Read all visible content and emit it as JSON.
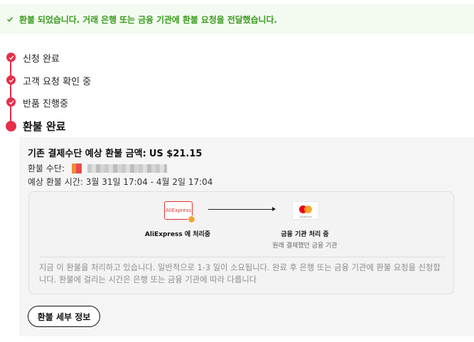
{
  "banner": {
    "message": "환불 되었습니다. 거래 은행 또는 금융 기관에 환불 요청을 전달했습니다.",
    "icon": "check-icon",
    "color": "#3b9c1f"
  },
  "timeline": {
    "accent": "#e62e4d",
    "steps": [
      {
        "label": "신청 완료",
        "icon": "check-icon"
      },
      {
        "label": "고객 요청 확인 중",
        "icon": "check-icon"
      },
      {
        "label": "반품 진행중",
        "icon": "check-icon"
      },
      {
        "label": "환불 완료",
        "icon": "dot-icon"
      }
    ]
  },
  "refund": {
    "title": "기존 결제수단 예상 환불 금액:",
    "amount": "US $21.15",
    "method_label": "환불 수단:",
    "time_text": "예상 환불 시간: 3월 31일 17:04 - 4월 2일 17:04",
    "flow": {
      "from_logo": "AliExpress",
      "from_label": "AliExpress 에 처리중",
      "to_label": "금융 기관 처리 중",
      "to_sublabel": "원래 결제했던 금융 기관",
      "to_logo_text": "mastercard"
    },
    "notice": "지금 이 환불을 처리하고 있습니다. 일반적으로 1-3 일이 소요됩니다. 완료 후 은행 또는 금융 기관에 환불 요청을 신청합니다. 환불에 걸리는 시간은 은행 또는 금융 기관에 따라 다릅니다",
    "detail_button": "환불 세부 정보"
  }
}
